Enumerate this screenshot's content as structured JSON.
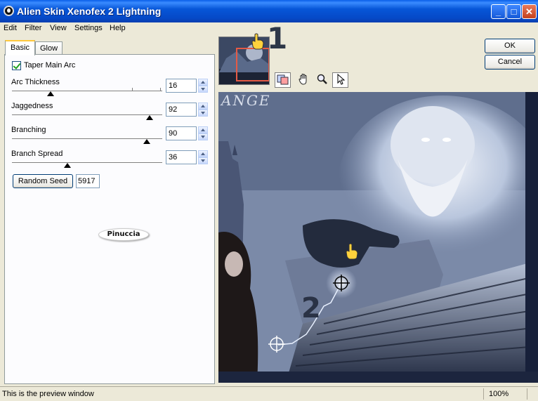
{
  "window": {
    "title": "Alien Skin Xenofex 2 Lightning",
    "minimize_label": "_",
    "maximize_label": "□",
    "close_label": "✕"
  },
  "menu": {
    "items": [
      "Edit",
      "Filter",
      "View",
      "Settings",
      "Help"
    ]
  },
  "tabs": [
    {
      "label": "Basic",
      "active": true
    },
    {
      "label": "Glow",
      "active": false
    }
  ],
  "controls": {
    "taper_main_arc": {
      "label": "Taper Main Arc",
      "checked": true
    },
    "arc_thickness": {
      "label": "Arc Thickness",
      "value": "16"
    },
    "jaggedness": {
      "label": "Jaggedness",
      "value": "92"
    },
    "branching": {
      "label": "Branching",
      "value": "90"
    },
    "branch_spread": {
      "label": "Branch Spread",
      "value": "36"
    },
    "random_seed": {
      "button_label": "Random Seed",
      "value": "5917"
    }
  },
  "watermark": {
    "text": "Pinuccia"
  },
  "annotations": {
    "step_one": "1",
    "step_two": "2"
  },
  "buttons": {
    "ok": "OK",
    "cancel": "Cancel"
  },
  "tools": [
    "preview-toggle-icon",
    "hand-icon",
    "zoom-icon",
    "arrow-cursor-icon"
  ],
  "preview": {
    "angel_text": "ANGE"
  },
  "statusbar": {
    "message": "This is the preview window",
    "zoom": "100%"
  },
  "colors": {
    "titlebar": "#0756d8",
    "thumb_highlight": "#e55a45",
    "checkmark": "#21a121"
  }
}
